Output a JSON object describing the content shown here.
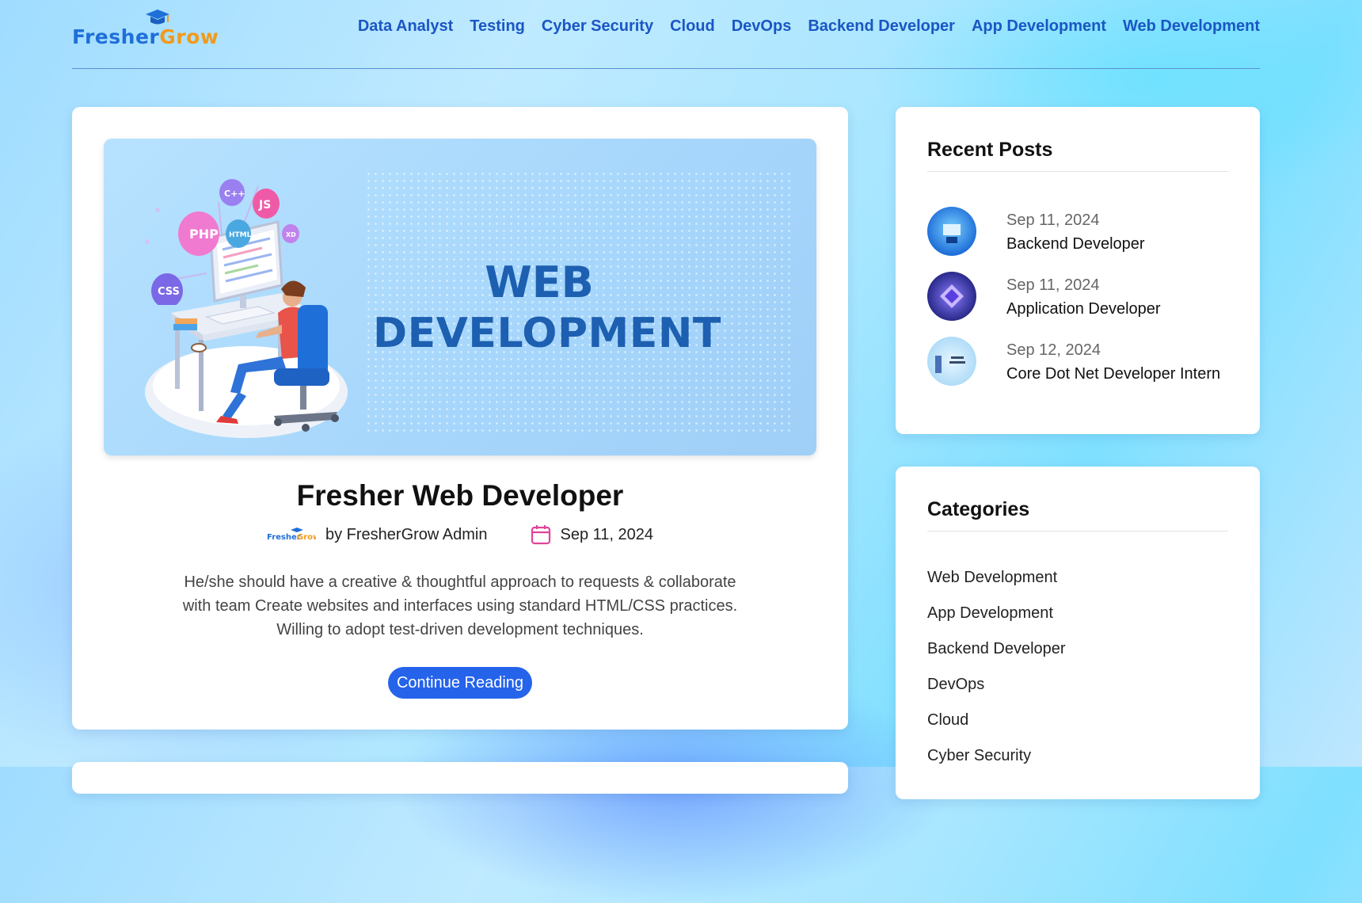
{
  "brand": {
    "logo_part1": "Fresher",
    "logo_part2": "Grow",
    "accent": "#1b56c4",
    "button_color": "#2563eb"
  },
  "nav": [
    "Data Analyst",
    "Testing",
    "Cyber Security",
    "Cloud",
    "DevOps",
    "Backend Developer",
    "App Development",
    "Web Development"
  ],
  "post": {
    "hero_line1": "WEB",
    "hero_line2": "DEVELOPMENT",
    "hero_badges": [
      "PHP",
      "C++",
      "JS",
      "HTML",
      "XD",
      "CSS"
    ],
    "title": "Fresher Web Developer",
    "author": "by FresherGrow Admin",
    "date": "Sep 11, 2024",
    "excerpt": "He/she should have a creative & thoughtful approach to requests & collaborate with team Create websites and interfaces using standard HTML/CSS practices. Willing to adopt test-driven development techniques.",
    "cta": "Continue Reading"
  },
  "sidebar": {
    "recent_title": "Recent Posts",
    "recent": [
      {
        "date": "Sep 11, 2024",
        "title": "Backend Developer",
        "icon": "backend-thumb"
      },
      {
        "date": "Sep 11, 2024",
        "title": "Application Developer",
        "icon": "app-thumb"
      },
      {
        "date": "Sep 12, 2024",
        "title": "Core Dot Net Developer Intern",
        "icon": "dotnet-thumb"
      }
    ],
    "categories_title": "Categories",
    "categories": [
      "Web Development",
      "App Development",
      "Backend Developer",
      "DevOps",
      "Cloud",
      "Cyber Security"
    ]
  }
}
